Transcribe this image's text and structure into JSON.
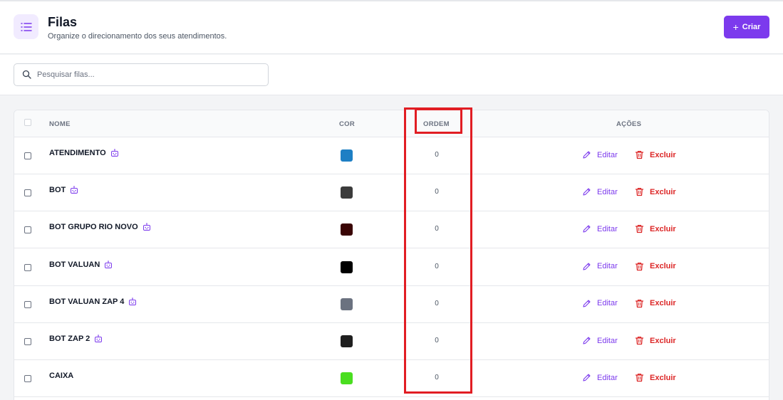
{
  "header": {
    "title": "Filas",
    "subtitle": "Organize o direcionamento dos seus atendimentos.",
    "create_label": "Criar"
  },
  "search": {
    "placeholder": "Pesquisar filas..."
  },
  "table": {
    "columns": {
      "name": "NOME",
      "color": "COR",
      "order": "ORDEM",
      "actions": "AÇÕES"
    },
    "edit_label": "Editar",
    "delete_label": "Excluir",
    "rows": [
      {
        "name": "ATENDIMENTO",
        "bot_icon": true,
        "color": "#1e7fc4",
        "order": "0"
      },
      {
        "name": "BOT",
        "bot_icon": true,
        "color": "#3b3b3b",
        "order": "0"
      },
      {
        "name": "BOT GRUPO RIO NOVO",
        "bot_icon": true,
        "color": "#3a0505",
        "order": "0"
      },
      {
        "name": "BOT VALUAN",
        "bot_icon": true,
        "color": "#000000",
        "order": "0"
      },
      {
        "name": "BOT VALUAN ZAP 4",
        "bot_icon": true,
        "color": "#6b7280",
        "order": "0"
      },
      {
        "name": "BOT ZAP 2",
        "bot_icon": true,
        "color": "#1f1f1f",
        "order": "0"
      },
      {
        "name": "CAIXA",
        "bot_icon": false,
        "color": "#4ade20",
        "order": "0"
      }
    ]
  },
  "colors": {
    "accent": "#7c3aed",
    "danger": "#dc2626",
    "highlight": "#e11d23"
  }
}
